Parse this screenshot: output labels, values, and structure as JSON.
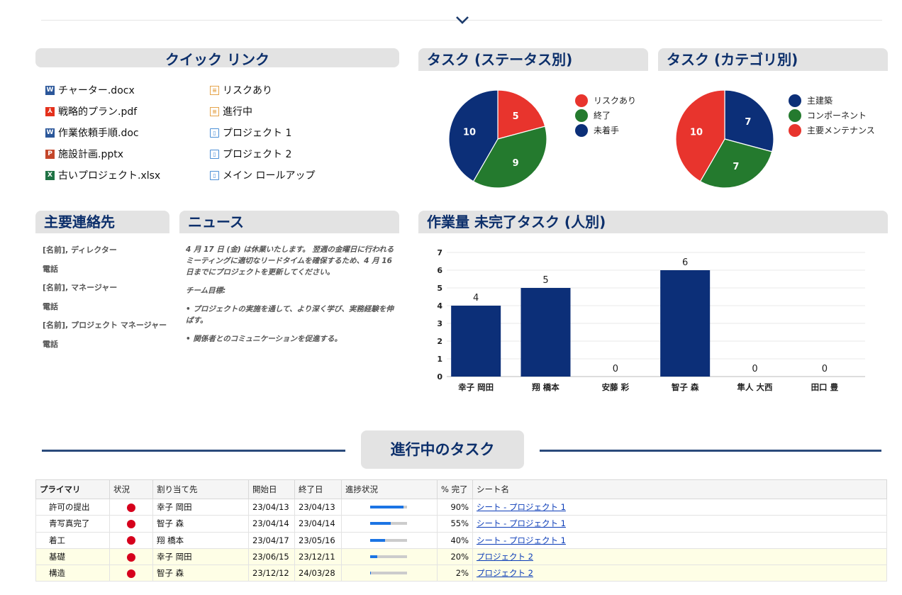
{
  "quick_links": {
    "title": "クイック リンク",
    "col1": [
      {
        "label": "チャーター.docx",
        "icon": "word-file-icon",
        "badge": "W"
      },
      {
        "label": "戦略的プラン.pdf",
        "icon": "pdf-file-icon",
        "badge": "⅄"
      },
      {
        "label": "作業依頼手順.doc",
        "icon": "word-file-icon",
        "badge": "W"
      },
      {
        "label": "施設計画.pptx",
        "icon": "powerpoint-file-icon",
        "badge": "P"
      },
      {
        "label": "古いプロジェクト.xlsx",
        "icon": "excel-file-icon",
        "badge": "X"
      }
    ],
    "col2": [
      {
        "label": "リスクあり",
        "icon": "report-icon",
        "badge": "≡"
      },
      {
        "label": "進行中",
        "icon": "report-icon",
        "badge": "≡"
      },
      {
        "label": "プロジェクト 1",
        "icon": "sheet-icon",
        "badge": "▯"
      },
      {
        "label": "プロジェクト 2",
        "icon": "sheet-icon",
        "badge": "▯"
      },
      {
        "label": "メイン ロールアップ",
        "icon": "sheet-icon",
        "badge": "▯"
      }
    ]
  },
  "status_chart": {
    "title": "タスク (ステータス別)"
  },
  "category_chart": {
    "title": "タスク (カテゴリ別)"
  },
  "chart_data": [
    {
      "type": "pie",
      "title": "タスク (ステータス別)",
      "legend_position": "right",
      "labels": [
        "リスクあり",
        "終了",
        "未着手"
      ],
      "values": [
        5,
        9,
        10
      ],
      "colors": [
        "#e8342d",
        "#247a2e",
        "#0c2f78"
      ]
    },
    {
      "type": "pie",
      "title": "タスク (カテゴリ別)",
      "legend_position": "right",
      "labels": [
        "主建築",
        "コンポーネント",
        "主要メンテナンス"
      ],
      "values": [
        7,
        7,
        10
      ],
      "colors": [
        "#0c2f78",
        "#247a2e",
        "#e8342d"
      ]
    },
    {
      "type": "bar",
      "title": "作業量 未完了タスク (人別)",
      "categories": [
        "幸子 岡田",
        "翔 橋本",
        "安藤 彩",
        "智子 森",
        "隼人 大西",
        "田口 豊"
      ],
      "values": [
        4,
        5,
        0,
        6,
        0,
        0
      ],
      "ylim": [
        0,
        7
      ],
      "yticks": [
        "0",
        "1",
        "2",
        "3",
        "4",
        "5",
        "6",
        "7"
      ],
      "grid": true,
      "color": "#0c2f78"
    }
  ],
  "contacts": {
    "title": "主要連絡先",
    "items": [
      "[名前], ディレクター",
      "電話",
      "[名前], マネージャー",
      "電話",
      "[名前], プロジェクト マネージャー",
      "電話"
    ]
  },
  "news": {
    "title": "ニュース",
    "para1": "4 月 17 日 (金) は休業いたします。 翌週の金曜日に行われるミーティングに適切なリードタイムを確保するため、4 月 16 日までにプロジェクトを更新してください。",
    "para2": "チーム目標:",
    "bullet1": "•  プロジェクトの実施を通して、より深く学び、実務経験を伸ばす。",
    "bullet2": "•  関係者とのコミュニケーションを促進する。"
  },
  "workload_chart": {
    "title": "作業量 未完了タスク (人別)"
  },
  "tasks_section": {
    "title": "進行中のタスク",
    "headers": [
      "プライマリ",
      "状況",
      "割り当て先",
      "開始日",
      "終了日",
      "進捗状況",
      "% 完了",
      "シート名"
    ],
    "rows": [
      {
        "primary": "許可の提出",
        "assignee": "幸子 岡田",
        "start": "23/04/13",
        "end": "23/04/13",
        "progress": 0.9,
        "pct": "90%",
        "sheet": "シート - プロジェクト 1",
        "highlight": false
      },
      {
        "primary": "青写真完了",
        "assignee": "智子 森",
        "start": "23/04/14",
        "end": "23/04/14",
        "progress": 0.55,
        "pct": "55%",
        "sheet": "シート - プロジェクト 1",
        "highlight": false
      },
      {
        "primary": "着工",
        "assignee": "翔 橋本",
        "start": "23/04/17",
        "end": "23/05/16",
        "progress": 0.4,
        "pct": "40%",
        "sheet": "シート - プロジェクト 1",
        "highlight": false
      },
      {
        "primary": "基礎",
        "assignee": "幸子 岡田",
        "start": "23/06/15",
        "end": "23/12/11",
        "progress": 0.2,
        "pct": "20%",
        "sheet": "プロジェクト 2",
        "highlight": true
      },
      {
        "primary": "構造",
        "assignee": "智子 森",
        "start": "23/12/12",
        "end": "24/03/28",
        "progress": 0.02,
        "pct": "2%",
        "sheet": "プロジェクト 2",
        "highlight": true
      }
    ]
  }
}
